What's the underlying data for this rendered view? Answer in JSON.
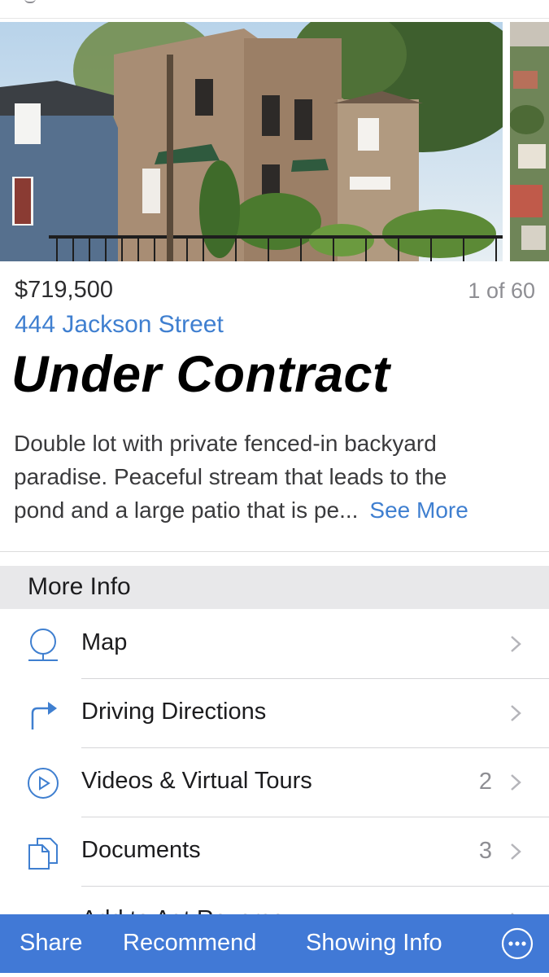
{
  "listing": {
    "price": "$719,500",
    "photo_counter": "1 of 60",
    "address": "444 Jackson Street",
    "status": "Under Contract",
    "description_lines": [
      "Double lot with private fenced-in backyard",
      "paradise. Peaceful stream that leads to the",
      "pond and a large patio that is pe..."
    ],
    "see_more_label": "See More"
  },
  "more_info": {
    "header": "More Info",
    "items": [
      {
        "label": "Map",
        "icon": "map-pin-icon",
        "count": ""
      },
      {
        "label": "Driving Directions",
        "icon": "directions-arrow-icon",
        "count": ""
      },
      {
        "label": "Videos & Virtual Tours",
        "icon": "play-circle-icon",
        "count": "2"
      },
      {
        "label": "Documents",
        "icon": "documents-icon",
        "count": "3"
      },
      {
        "label": "Add to Agt Reverse",
        "icon": "partial-icon",
        "count": ""
      }
    ]
  },
  "toolbar": {
    "share_label": "Share",
    "recommend_label": "Recommend",
    "showing_info_label": "Showing Info",
    "more_icon": "ellipsis-circle-icon"
  },
  "colors": {
    "accent": "#3f7fd0",
    "toolbar": "#4179d6",
    "section_bg": "#e8e8ea"
  }
}
